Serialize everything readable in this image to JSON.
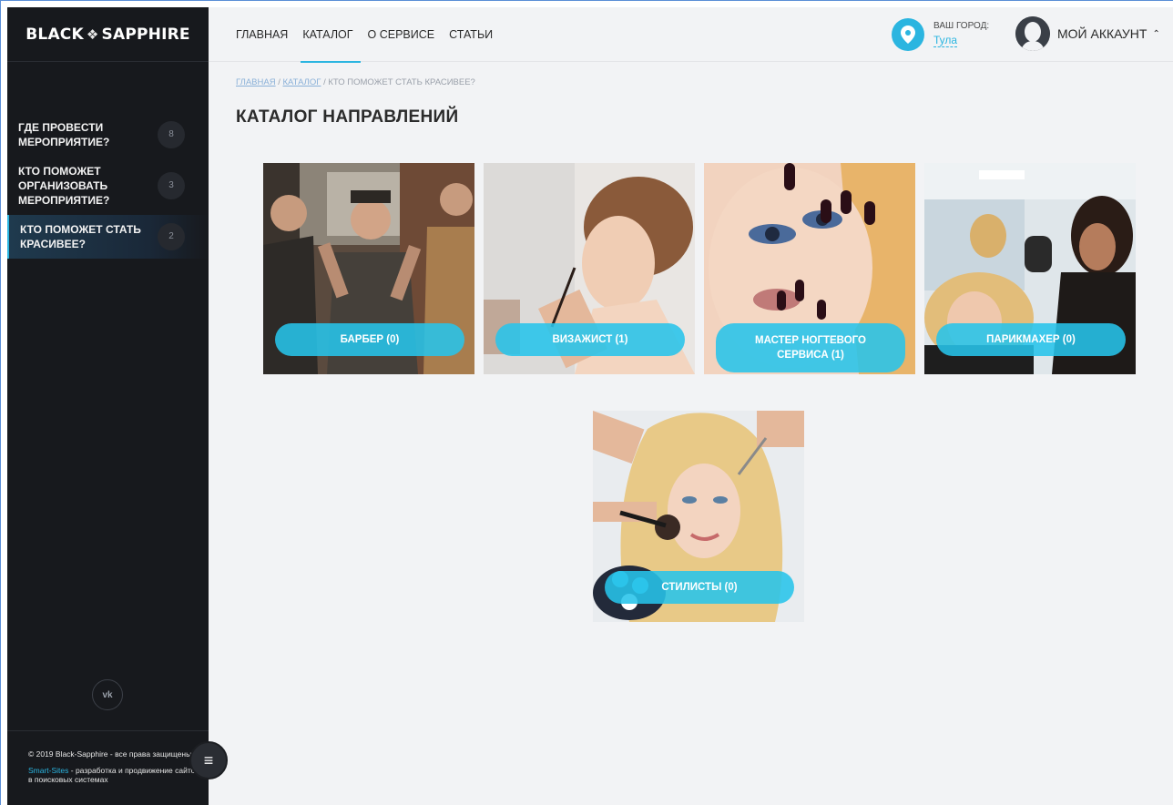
{
  "sidebar": {
    "logo_left": "BLACK",
    "logo_right": "SAPPHIRE",
    "items": [
      {
        "label": "ГДЕ ПРОВЕСТИ МЕРОПРИЯТИЕ?",
        "count": "8"
      },
      {
        "label": "КТО ПОМОЖЕТ ОРГАНИЗОВАТЬ МЕРОПРИЯТИЕ?",
        "count": "3"
      },
      {
        "label": "КТО ПОМОЖЕТ СТАТЬ КРАСИВЕЕ?",
        "count": "2"
      }
    ],
    "vk_label": "vk",
    "copyright": "© 2019 Black-Sapphire - все права защищены",
    "dev_link": "Smart-Sites",
    "dev_text": " - разработка и продвижение сайтов в поисковых системах"
  },
  "nav": {
    "items": [
      "ГЛАВНАЯ",
      "КАТАЛОГ",
      "О СЕРВИСЕ",
      "СТАТЬИ"
    ]
  },
  "city": {
    "label": "ВАШ ГОРОД:",
    "value": "Тула"
  },
  "account": {
    "label": "МОЙ АККАУНТ"
  },
  "breadcrumb": {
    "home": "ГЛАВНАЯ",
    "sep1": " / ",
    "catalog": "КАТАЛОГ",
    "sep2": " / ",
    "current": "КТО ПОМОЖЕТ СТАТЬ КРАСИВЕЕ?"
  },
  "page_title": "КАТАЛОГ НАПРАВЛЕНИЙ",
  "cards": [
    {
      "label": "БАРБЕР (0)"
    },
    {
      "label": "ВИЗАЖИСТ (1)"
    },
    {
      "label": "МАСТЕР НОГТЕВОГО СЕРВИСА (1)"
    },
    {
      "label": "ПАРИКМАХЕР (0)"
    },
    {
      "label": "СТИЛИСТЫ (0)"
    }
  ],
  "colors": {
    "accent": "#2bb5e0",
    "sidebar_bg": "#17191d",
    "page_bg": "#f2f3f5"
  }
}
